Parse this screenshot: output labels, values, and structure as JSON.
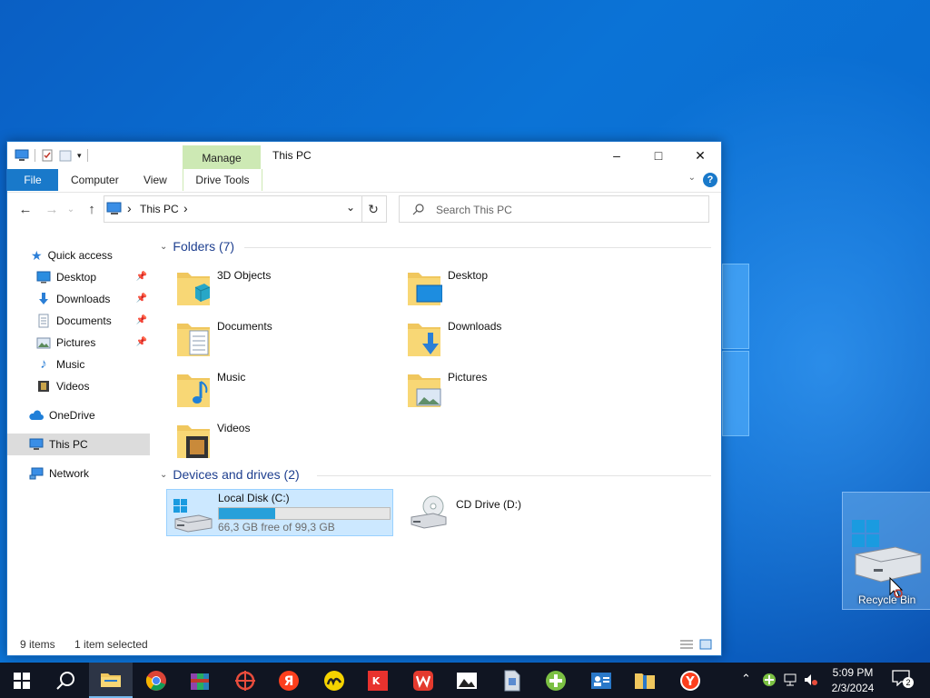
{
  "window": {
    "title": "This PC",
    "contextual_tab": "Manage",
    "contextual_group": "Drive Tools",
    "ribbon_tabs": [
      "File",
      "Computer",
      "View"
    ],
    "minimize": "–",
    "maximize": "□",
    "close": "✕",
    "help": "?"
  },
  "nav": {
    "back": "←",
    "forward": "→",
    "up": "↑",
    "address_chevron": "›",
    "address_location": "This PC",
    "address_dropdown": "⌄",
    "refresh": "↻",
    "search_placeholder": "Search This PC"
  },
  "sidebar": {
    "quick_access": "Quick access",
    "quick_items": [
      {
        "label": "Desktop",
        "pinned": true
      },
      {
        "label": "Downloads",
        "pinned": true
      },
      {
        "label": "Documents",
        "pinned": true
      },
      {
        "label": "Pictures",
        "pinned": true
      },
      {
        "label": "Music",
        "pinned": false
      },
      {
        "label": "Videos",
        "pinned": false
      }
    ],
    "onedrive": "OneDrive",
    "this_pc": "This PC",
    "network": "Network"
  },
  "content": {
    "folders_header": "Folders (7)",
    "folders": [
      "3D Objects",
      "Desktop",
      "Documents",
      "Downloads",
      "Music",
      "Pictures",
      "Videos"
    ],
    "drives_header": "Devices and drives (2)",
    "drives": [
      {
        "name": "Local Disk (C:)",
        "free_text": "66,3 GB free of 99,3 GB",
        "used_fraction": 0.33
      },
      {
        "name": "CD Drive (D:)"
      }
    ]
  },
  "status": {
    "items": "9 items",
    "selected": "1 item selected"
  },
  "desktop": {
    "recycle_bin_label": "Recycle Bin"
  },
  "taskbar": {
    "time": "5:09 PM",
    "date": "2/3/2024",
    "notification_count": "2"
  },
  "colors": {
    "accent": "#1979ca",
    "selection": "#cce8ff",
    "manage_tab": "#cde9b4",
    "drive_bar": "#26a0da",
    "desktop": "#0a6bd0",
    "taskbar": "#101522"
  }
}
